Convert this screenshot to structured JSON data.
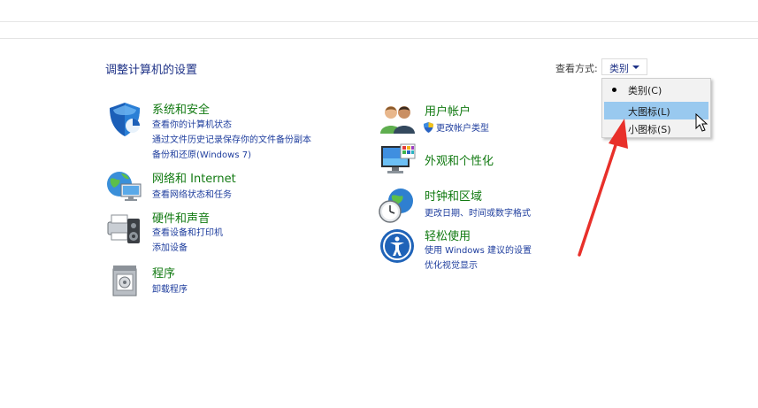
{
  "header": {
    "title": "调整计算机的设置",
    "view_by_label": "查看方式:",
    "view_by_value": "类别"
  },
  "view_menu": {
    "items": [
      {
        "label": "类别(C)",
        "checked": true
      },
      {
        "label": "大图标(L)",
        "highlighted": true
      },
      {
        "label": "小图标(S)"
      }
    ]
  },
  "categories": {
    "system": {
      "title": "系统和安全",
      "links": [
        "查看你的计算机状态",
        "通过文件历史记录保存你的文件备份副本",
        "备份和还原(Windows 7)"
      ]
    },
    "network": {
      "title": "网络和 Internet",
      "links": [
        "查看网络状态和任务"
      ]
    },
    "hardware": {
      "title": "硬件和声音",
      "links": [
        "查看设备和打印机",
        "添加设备"
      ]
    },
    "programs": {
      "title": "程序",
      "links": [
        "卸载程序"
      ]
    },
    "users": {
      "title": "用户帐户",
      "links": [
        "更改帐户类型"
      ]
    },
    "appearance": {
      "title": "外观和个性化",
      "links": []
    },
    "clock": {
      "title": "时钟和区域",
      "links": [
        "更改日期、时间或数字格式"
      ]
    },
    "ease": {
      "title": "轻松使用",
      "links": [
        "使用 Windows 建议的设置",
        "优化视觉显示"
      ]
    }
  },
  "colors": {
    "category_title": "#127a12",
    "link": "#1f3e9e",
    "menu_highlight": "#99c9ef",
    "annotation_arrow": "#e8302a"
  }
}
